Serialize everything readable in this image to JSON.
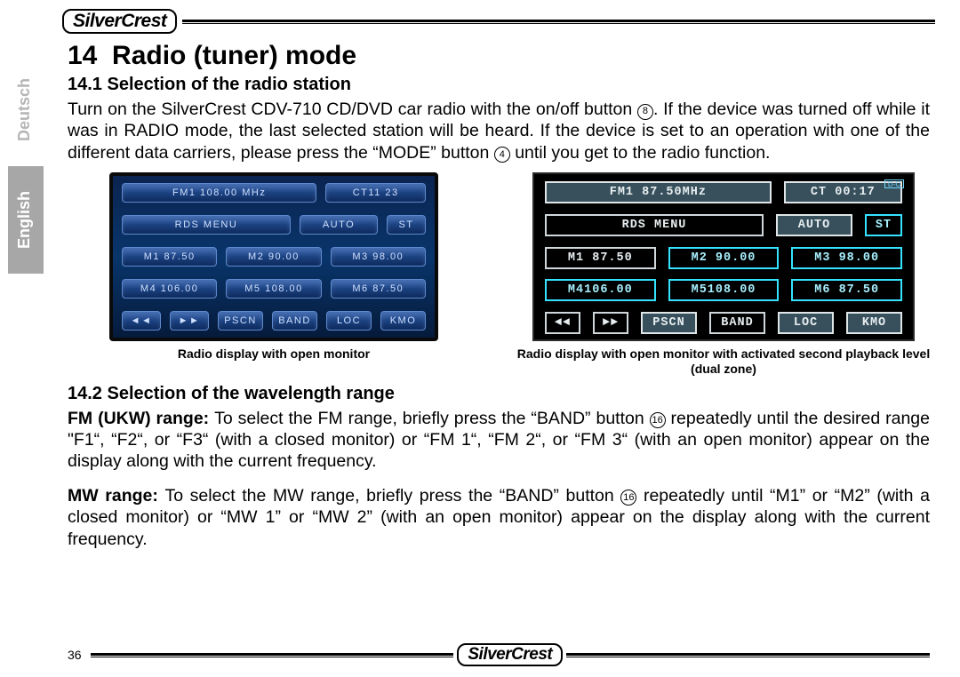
{
  "brand": "SilverCrest",
  "languages": {
    "de": "Deutsch",
    "en": "English"
  },
  "section": {
    "num": "14",
    "title": "Radio (tuner) mode"
  },
  "sub1": {
    "num": "14.1",
    "title": "Selection of the radio station"
  },
  "para1a": "Turn on the SilverCrest CDV-710 CD/DVD car radio with the on/off button ",
  "para1_ref1": "8",
  "para1b": ". If the device was turned off while it was in RADIO mode, the last selected station will be heard. If the device is set to an operation with one of the different data carriers, please press the “MODE” button ",
  "para1_ref2": "4",
  "para1c": " until you get to the radio function.",
  "radio1": {
    "r1": [
      "FM1   108.00 MHz",
      "CT11 23"
    ],
    "r2": [
      "RDS MENU",
      "AUTO",
      "ST"
    ],
    "r3": [
      "M1  87.50",
      "M2  90.00",
      "M3  98.00"
    ],
    "r4": [
      "M4 106.00",
      "M5 108.00",
      "M6  87.50"
    ],
    "r5": [
      "◄◄",
      "►►",
      "PSCN",
      "BAND",
      "LOC",
      "KMO"
    ]
  },
  "caption1": "Radio display with open monitor",
  "radio2": {
    "dot": "D-C",
    "r1": [
      "FM1   87.50MHz",
      "CT 00:17"
    ],
    "r2": [
      "RDS MENU",
      "AUTO",
      "ST"
    ],
    "r3": [
      "M1 87.50",
      "M2 90.00",
      "M3 98.00"
    ],
    "r4": [
      "M4106.00",
      "M5108.00",
      "M6 87.50"
    ],
    "r5": [
      "◄◄",
      "►►",
      "PSCN",
      "BAND",
      "LOC",
      "KMO"
    ]
  },
  "caption2": "Radio display with open monitor with activated second playback level (dual zone)",
  "sub2": {
    "num": "14.2",
    "title": "Selection of the wavelength range"
  },
  "para2_lead": "FM (UKW) range: ",
  "para2a": "To select the FM range, briefly press the “BAND” button ",
  "para2_ref": "16",
  "para2b": " repeatedly until the desired range \"F1“, “F2“, or “F3“ (with a closed monitor) or “FM 1“, “FM 2“, or “FM 3“ (with an open monitor) appear on the display along with the current frequency.",
  "para3_lead": "MW range: ",
  "para3a": "To select the MW range, briefly press the “BAND” button ",
  "para3_ref": "16",
  "para3b": " repeatedly until “M1” or “M2” (with a closed monitor) or “MW 1” or “MW 2” (with an open monitor) appear on the display along with the current frequency.",
  "page_number": "36"
}
